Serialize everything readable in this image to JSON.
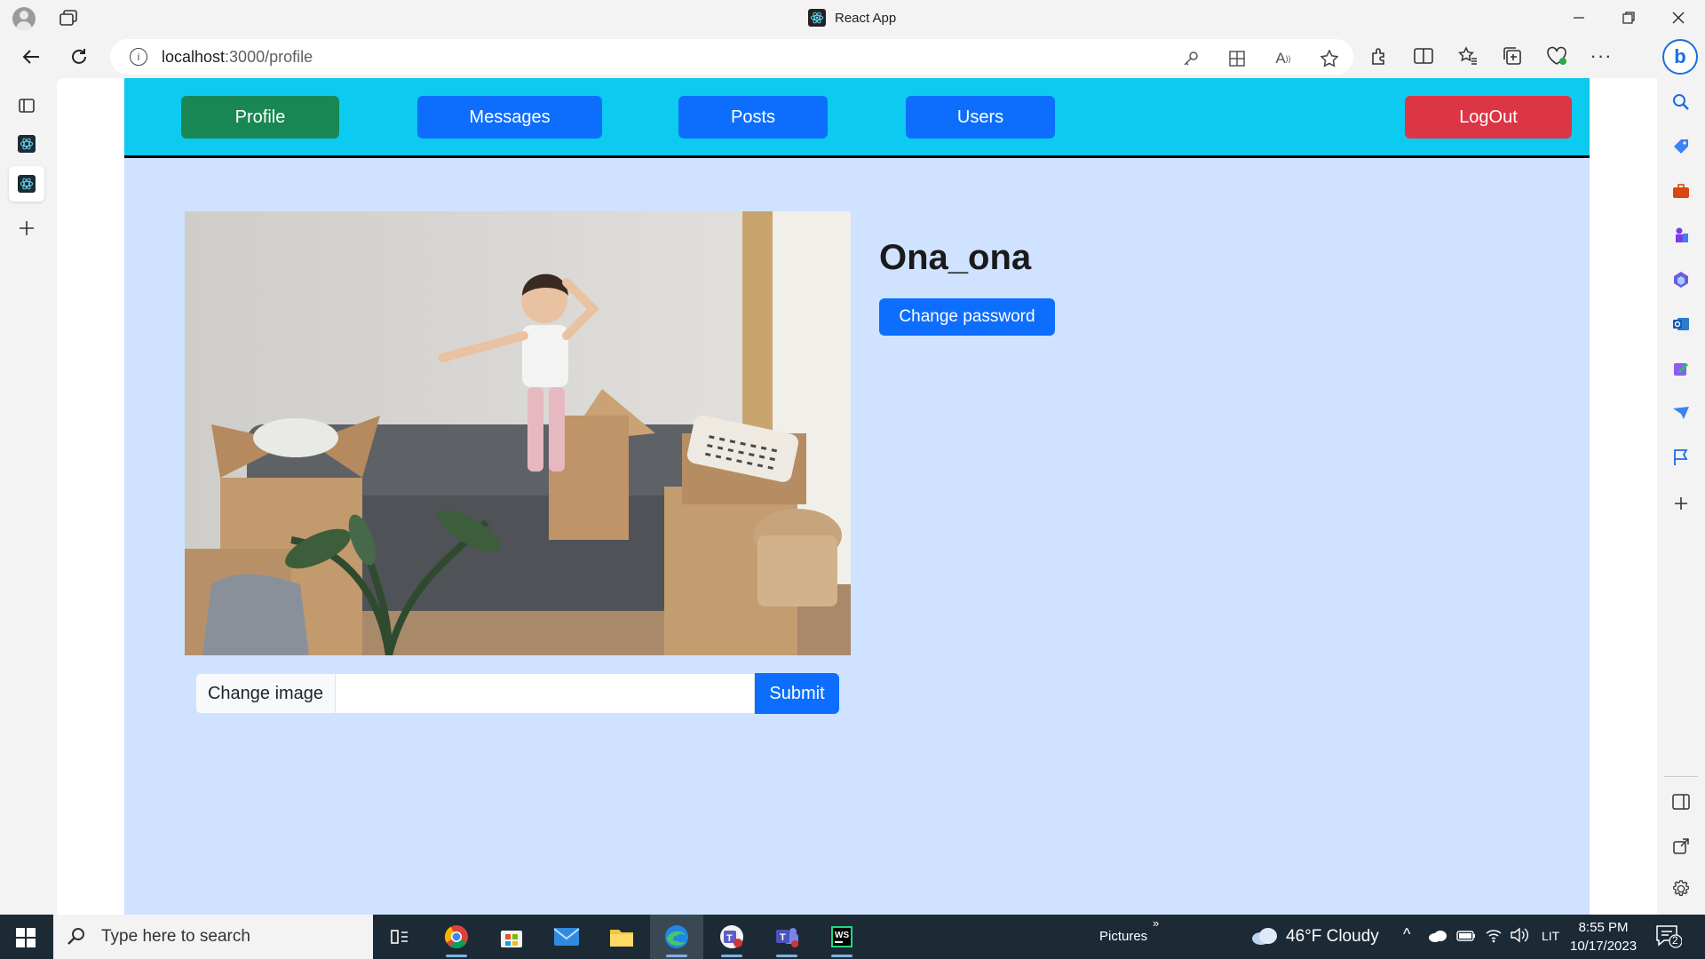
{
  "window": {
    "title": "React App"
  },
  "browser": {
    "url_host": "localhost",
    "url_path": ":3000/profile"
  },
  "nav": {
    "profile": "Profile",
    "messages": "Messages",
    "posts": "Posts",
    "users": "Users",
    "logout": "LogOut"
  },
  "profile": {
    "username": "Ona_ona",
    "change_password": "Change password",
    "change_image": "Change image",
    "submit": "Submit"
  },
  "taskbar": {
    "search_placeholder": "Type here to search",
    "pictures": "Pictures",
    "weather": "46°F  Cloudy",
    "lang": "LIT",
    "time": "8:55 PM",
    "date": "10/17/2023",
    "notifications": "2"
  },
  "colors": {
    "navbar": "#0dcaf0",
    "page_bg": "#cfe2ff",
    "primary": "#0d6efd",
    "success": "#198754",
    "danger": "#dc3545"
  }
}
